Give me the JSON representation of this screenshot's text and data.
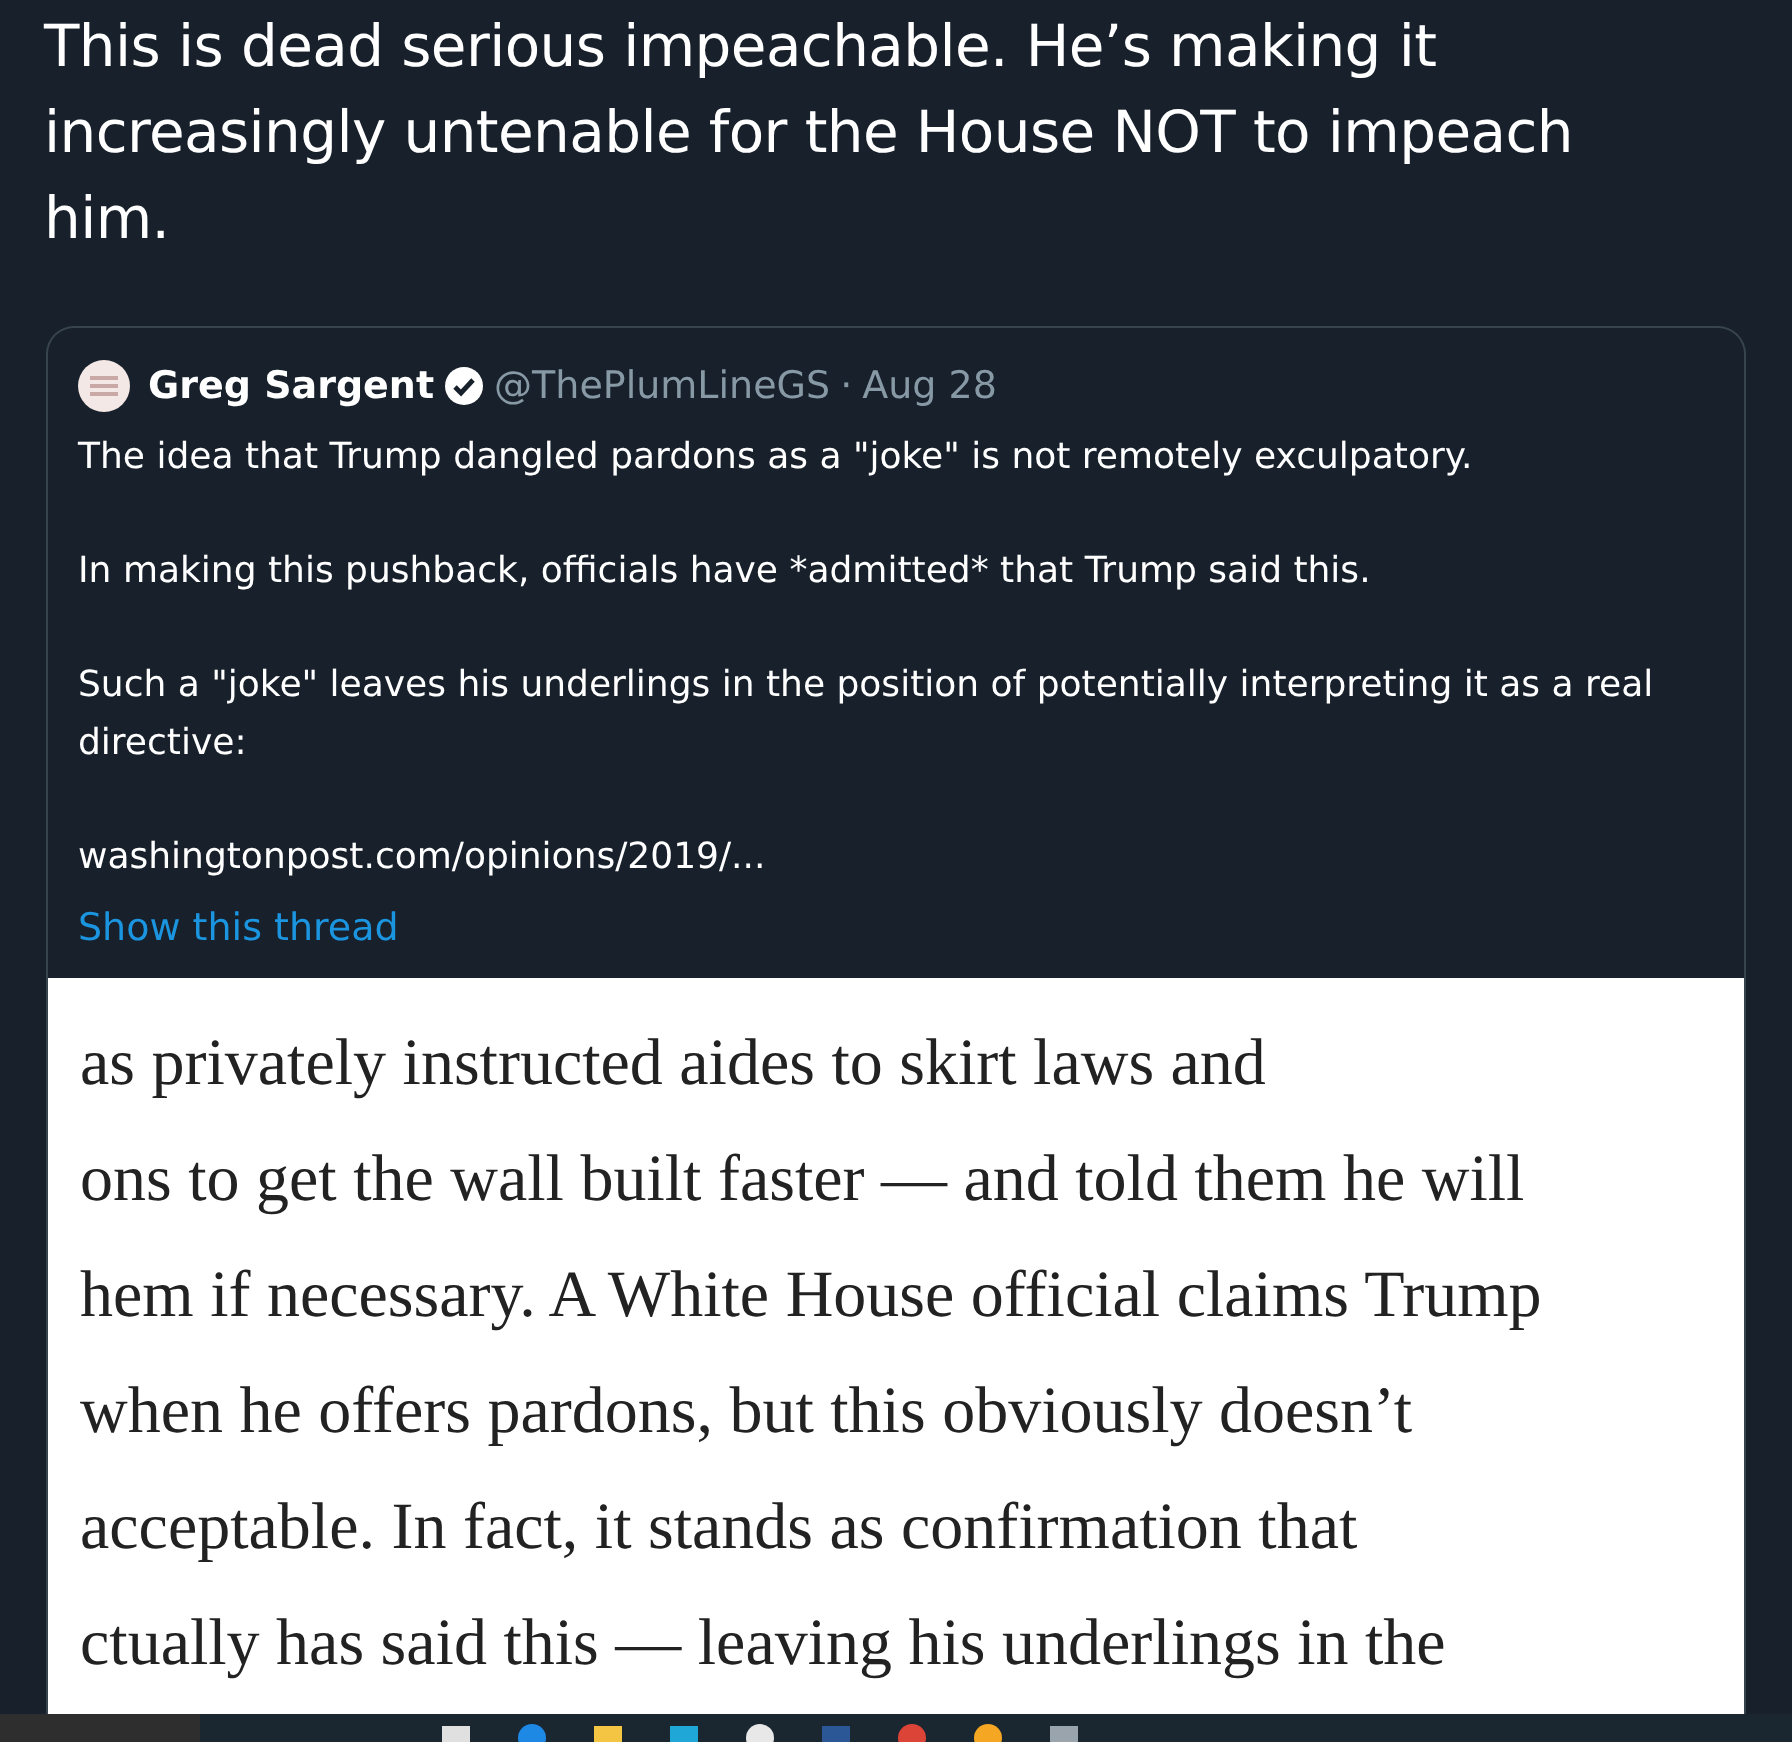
{
  "tweet_text": "This is dead serious impeachable. He’s making it increasingly untenable for the House NOT to impeach him.",
  "quoted_tweet": {
    "author": "Greg Sargent",
    "verified": true,
    "handle": "@ThePlumLineGS",
    "separator": "·",
    "date": "Aug 28",
    "paragraphs": [
      "The idea that Trump dangled pardons as a \"joke\" is not remotely exculpatory.",
      "In making this pushback, officials have *admitted* that Trump said this.",
      "Such a \"joke\" leaves his underlings in the position of potentially interpreting it as a real directive:",
      "washingtonpost.com/opinions/2019/..."
    ],
    "thread_link": "Show this thread",
    "article_lines": [
      "as privately instructed aides to skirt laws and",
      "ons to get the wall built faster — and told them he will",
      "hem if necessary. A White House official claims Trump",
      "when he offers pardons, but this obviously doesn’t",
      "acceptable. In fact, it stands as confirmation that",
      "ctually has said this — leaving his underlings in the"
    ]
  },
  "taskbar": {
    "icons": [
      {
        "kind": "square",
        "color": "#e0e0e0"
      },
      {
        "kind": "circle",
        "color": "#1e88e5"
      },
      {
        "kind": "square",
        "color": "#f4c542"
      },
      {
        "kind": "square",
        "color": "#1fa7d8"
      },
      {
        "kind": "circle",
        "color": "#e8e8e8"
      },
      {
        "kind": "square",
        "color": "#2b5797"
      },
      {
        "kind": "circle",
        "color": "#db4437"
      },
      {
        "kind": "circle",
        "color": "#f5a623"
      },
      {
        "kind": "square",
        "color": "#9aa4ad"
      }
    ]
  }
}
